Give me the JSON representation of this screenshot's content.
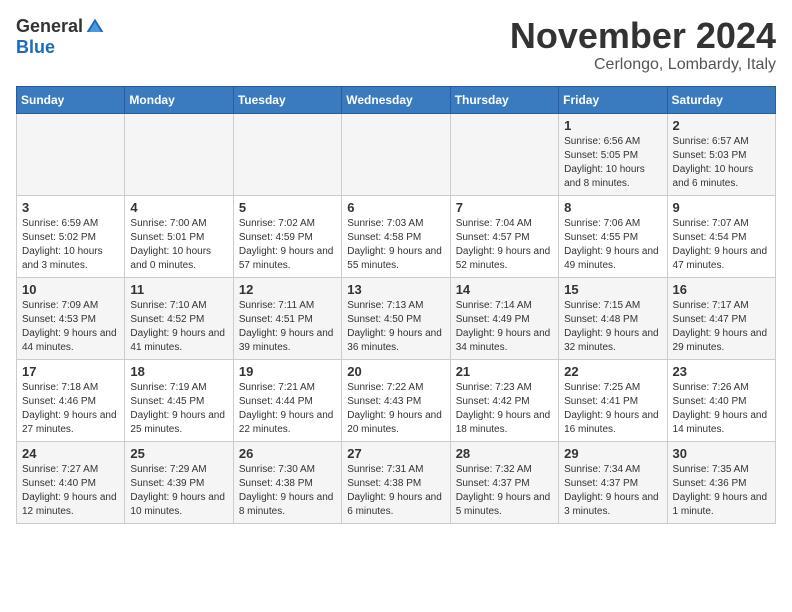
{
  "logo": {
    "general": "General",
    "blue": "Blue"
  },
  "title": "November 2024",
  "subtitle": "Cerlongo, Lombardy, Italy",
  "days_of_week": [
    "Sunday",
    "Monday",
    "Tuesday",
    "Wednesday",
    "Thursday",
    "Friday",
    "Saturday"
  ],
  "weeks": [
    [
      {
        "day": "",
        "info": ""
      },
      {
        "day": "",
        "info": ""
      },
      {
        "day": "",
        "info": ""
      },
      {
        "day": "",
        "info": ""
      },
      {
        "day": "",
        "info": ""
      },
      {
        "day": "1",
        "info": "Sunrise: 6:56 AM\nSunset: 5:05 PM\nDaylight: 10 hours\nand 8 minutes."
      },
      {
        "day": "2",
        "info": "Sunrise: 6:57 AM\nSunset: 5:03 PM\nDaylight: 10 hours\nand 6 minutes."
      }
    ],
    [
      {
        "day": "3",
        "info": "Sunrise: 6:59 AM\nSunset: 5:02 PM\nDaylight: 10 hours\nand 3 minutes."
      },
      {
        "day": "4",
        "info": "Sunrise: 7:00 AM\nSunset: 5:01 PM\nDaylight: 10 hours\nand 0 minutes."
      },
      {
        "day": "5",
        "info": "Sunrise: 7:02 AM\nSunset: 4:59 PM\nDaylight: 9 hours\nand 57 minutes."
      },
      {
        "day": "6",
        "info": "Sunrise: 7:03 AM\nSunset: 4:58 PM\nDaylight: 9 hours\nand 55 minutes."
      },
      {
        "day": "7",
        "info": "Sunrise: 7:04 AM\nSunset: 4:57 PM\nDaylight: 9 hours\nand 52 minutes."
      },
      {
        "day": "8",
        "info": "Sunrise: 7:06 AM\nSunset: 4:55 PM\nDaylight: 9 hours\nand 49 minutes."
      },
      {
        "day": "9",
        "info": "Sunrise: 7:07 AM\nSunset: 4:54 PM\nDaylight: 9 hours\nand 47 minutes."
      }
    ],
    [
      {
        "day": "10",
        "info": "Sunrise: 7:09 AM\nSunset: 4:53 PM\nDaylight: 9 hours\nand 44 minutes."
      },
      {
        "day": "11",
        "info": "Sunrise: 7:10 AM\nSunset: 4:52 PM\nDaylight: 9 hours\nand 41 minutes."
      },
      {
        "day": "12",
        "info": "Sunrise: 7:11 AM\nSunset: 4:51 PM\nDaylight: 9 hours\nand 39 minutes."
      },
      {
        "day": "13",
        "info": "Sunrise: 7:13 AM\nSunset: 4:50 PM\nDaylight: 9 hours\nand 36 minutes."
      },
      {
        "day": "14",
        "info": "Sunrise: 7:14 AM\nSunset: 4:49 PM\nDaylight: 9 hours\nand 34 minutes."
      },
      {
        "day": "15",
        "info": "Sunrise: 7:15 AM\nSunset: 4:48 PM\nDaylight: 9 hours\nand 32 minutes."
      },
      {
        "day": "16",
        "info": "Sunrise: 7:17 AM\nSunset: 4:47 PM\nDaylight: 9 hours\nand 29 minutes."
      }
    ],
    [
      {
        "day": "17",
        "info": "Sunrise: 7:18 AM\nSunset: 4:46 PM\nDaylight: 9 hours\nand 27 minutes."
      },
      {
        "day": "18",
        "info": "Sunrise: 7:19 AM\nSunset: 4:45 PM\nDaylight: 9 hours\nand 25 minutes."
      },
      {
        "day": "19",
        "info": "Sunrise: 7:21 AM\nSunset: 4:44 PM\nDaylight: 9 hours\nand 22 minutes."
      },
      {
        "day": "20",
        "info": "Sunrise: 7:22 AM\nSunset: 4:43 PM\nDaylight: 9 hours\nand 20 minutes."
      },
      {
        "day": "21",
        "info": "Sunrise: 7:23 AM\nSunset: 4:42 PM\nDaylight: 9 hours\nand 18 minutes."
      },
      {
        "day": "22",
        "info": "Sunrise: 7:25 AM\nSunset: 4:41 PM\nDaylight: 9 hours\nand 16 minutes."
      },
      {
        "day": "23",
        "info": "Sunrise: 7:26 AM\nSunset: 4:40 PM\nDaylight: 9 hours\nand 14 minutes."
      }
    ],
    [
      {
        "day": "24",
        "info": "Sunrise: 7:27 AM\nSunset: 4:40 PM\nDaylight: 9 hours\nand 12 minutes."
      },
      {
        "day": "25",
        "info": "Sunrise: 7:29 AM\nSunset: 4:39 PM\nDaylight: 9 hours\nand 10 minutes."
      },
      {
        "day": "26",
        "info": "Sunrise: 7:30 AM\nSunset: 4:38 PM\nDaylight: 9 hours\nand 8 minutes."
      },
      {
        "day": "27",
        "info": "Sunrise: 7:31 AM\nSunset: 4:38 PM\nDaylight: 9 hours\nand 6 minutes."
      },
      {
        "day": "28",
        "info": "Sunrise: 7:32 AM\nSunset: 4:37 PM\nDaylight: 9 hours\nand 5 minutes."
      },
      {
        "day": "29",
        "info": "Sunrise: 7:34 AM\nSunset: 4:37 PM\nDaylight: 9 hours\nand 3 minutes."
      },
      {
        "day": "30",
        "info": "Sunrise: 7:35 AM\nSunset: 4:36 PM\nDaylight: 9 hours\nand 1 minute."
      }
    ]
  ]
}
